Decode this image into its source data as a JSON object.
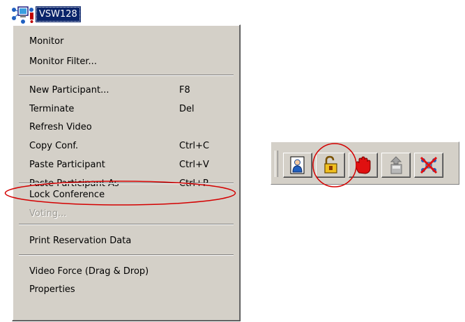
{
  "tree": {
    "node_label": "VSW128",
    "icon": "conference-node-icon"
  },
  "menu": {
    "items": [
      {
        "label": "Monitor",
        "shortcut": ""
      },
      {
        "label": "Monitor Filter...",
        "shortcut": ""
      },
      {
        "label": "New Participant...",
        "shortcut": "F8"
      },
      {
        "label": "Terminate",
        "shortcut": "Del"
      },
      {
        "label": "Refresh Video",
        "shortcut": ""
      },
      {
        "label": "Copy Conf.",
        "shortcut": "Ctrl+C"
      },
      {
        "label": "Paste Participant",
        "shortcut": "Ctrl+V"
      },
      {
        "label": "Paste Participant As",
        "shortcut": "Ctrl+P"
      },
      {
        "label": "Lock Conference",
        "shortcut": ""
      },
      {
        "label": "Voting...",
        "shortcut": "",
        "disabled": true
      },
      {
        "label": "Print Reservation Data",
        "shortcut": ""
      },
      {
        "label": "Video Force (Drag & Drop)",
        "shortcut": ""
      },
      {
        "label": "Properties",
        "shortcut": ""
      }
    ]
  },
  "toolbar": {
    "buttons": [
      "participant-icon",
      "unlock-icon",
      "stop-hand-icon",
      "eject-icon",
      "disconnect-icon"
    ]
  },
  "colors": {
    "selection": "#0a246a",
    "highlight": "#d40000",
    "menu_bg": "#d4d0c8"
  }
}
